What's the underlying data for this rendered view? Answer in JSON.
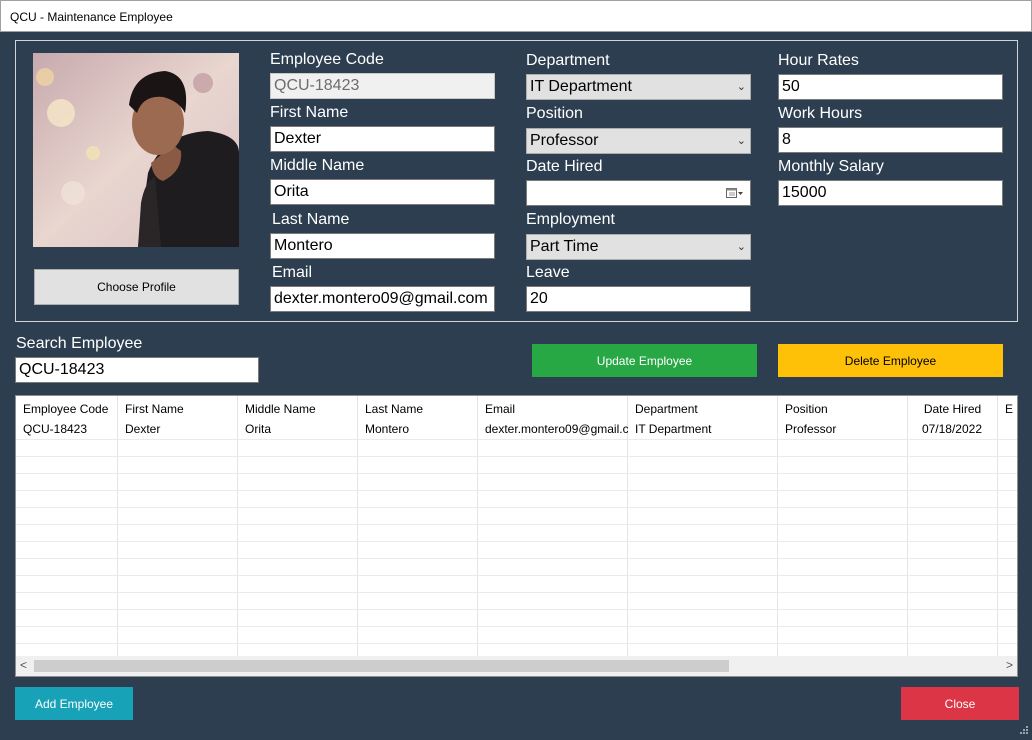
{
  "window": {
    "title": "QCU - Maintenance Employee"
  },
  "form": {
    "choose_profile": "Choose Profile",
    "employee_code": {
      "label": "Employee Code",
      "value": "QCU-18423"
    },
    "first_name": {
      "label": "First Name",
      "value": "Dexter"
    },
    "middle_name": {
      "label": "Middle Name",
      "value": "Orita"
    },
    "last_name": {
      "label": "Last Name",
      "value": "Montero"
    },
    "email": {
      "label": "Email",
      "value": "dexter.montero09@gmail.com"
    },
    "department": {
      "label": "Department",
      "value": "IT Department"
    },
    "position": {
      "label": "Position",
      "value": "Professor"
    },
    "date_hired": {
      "label": "Date Hired",
      "value": ""
    },
    "employment": {
      "label": "Employment",
      "value": "Part Time"
    },
    "leave": {
      "label": "Leave",
      "value": "20"
    },
    "hour_rates": {
      "label": "Hour Rates",
      "value": "50"
    },
    "work_hours": {
      "label": "Work Hours",
      "value": "8"
    },
    "monthly_salary": {
      "label": "Monthly Salary",
      "value": "15000"
    }
  },
  "search": {
    "label": "Search Employee",
    "value": "QCU-18423"
  },
  "buttons": {
    "update": "Update Employee",
    "delete": "Delete Employee",
    "add": "Add Employee",
    "close": "Close"
  },
  "colors": {
    "update": "#28a745",
    "delete": "#ffc107",
    "add": "#17a2b8",
    "close": "#dc3545",
    "background": "#2c3e50"
  },
  "table": {
    "columns": [
      "Employee Code",
      "First Name",
      "Middle Name",
      "Last Name",
      "Email",
      "Department",
      "Position",
      "Date Hired",
      "E"
    ],
    "rows": [
      [
        "QCU-18423",
        "Dexter",
        "Orita",
        "Montero",
        "dexter.montero09@gmail.c...",
        "IT Department",
        "Professor",
        "07/18/2022",
        ""
      ]
    ]
  },
  "scrollbar": {
    "left_arrow": "<",
    "right_arrow": ">"
  }
}
